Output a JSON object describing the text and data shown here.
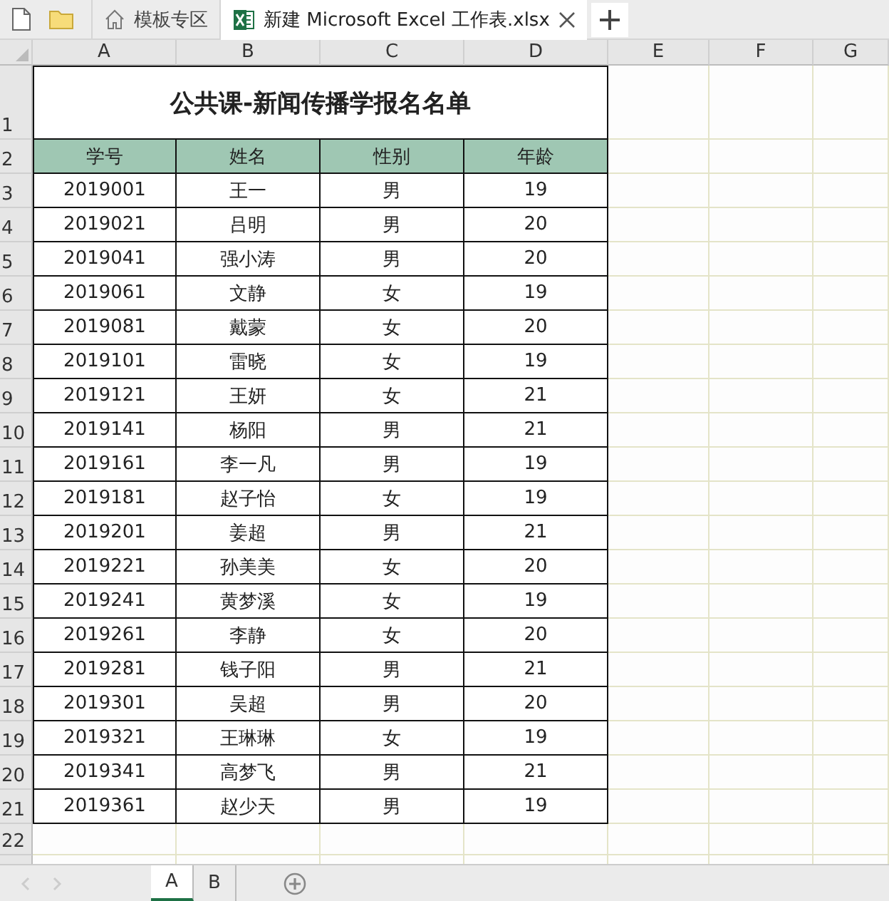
{
  "tabs": [
    {
      "label": "模板专区",
      "kind": "home",
      "selected": false
    },
    {
      "label": "新建 Microsoft Excel 工作表.xlsx",
      "kind": "excel",
      "selected": true
    }
  ],
  "columns": [
    "A",
    "B",
    "C",
    "D",
    "E",
    "F",
    "G"
  ],
  "row_numbers": [
    "1",
    "2",
    "3",
    "4",
    "5",
    "6",
    "7",
    "8",
    "9",
    "10",
    "11",
    "12",
    "13",
    "14",
    "15",
    "16",
    "17",
    "18",
    "19",
    "20",
    "21",
    "22"
  ],
  "title": "公共课-新闻传播学报名名单",
  "table": {
    "header": [
      "学号",
      "姓名",
      "性别",
      "年龄"
    ],
    "rows": [
      [
        "2019001",
        "王一",
        "男",
        "19"
      ],
      [
        "2019021",
        "吕明",
        "男",
        "20"
      ],
      [
        "2019041",
        "强小涛",
        "男",
        "20"
      ],
      [
        "2019061",
        "文静",
        "女",
        "19"
      ],
      [
        "2019081",
        "戴蒙",
        "女",
        "20"
      ],
      [
        "2019101",
        "雷晓",
        "女",
        "19"
      ],
      [
        "2019121",
        "王妍",
        "女",
        "21"
      ],
      [
        "2019141",
        "杨阳",
        "男",
        "21"
      ],
      [
        "2019161",
        "李一凡",
        "男",
        "19"
      ],
      [
        "2019181",
        "赵子怡",
        "女",
        "19"
      ],
      [
        "2019201",
        "姜超",
        "男",
        "21"
      ],
      [
        "2019221",
        "孙美美",
        "女",
        "20"
      ],
      [
        "2019241",
        "黄梦溪",
        "女",
        "19"
      ],
      [
        "2019261",
        "李静",
        "女",
        "20"
      ],
      [
        "2019281",
        "钱子阳",
        "男",
        "21"
      ],
      [
        "2019301",
        "吴超",
        "男",
        "20"
      ],
      [
        "2019321",
        "王琳琳",
        "女",
        "19"
      ],
      [
        "2019341",
        "高梦飞",
        "男",
        "21"
      ],
      [
        "2019361",
        "赵少天",
        "男",
        "19"
      ]
    ]
  },
  "sheets": [
    {
      "label": "A",
      "selected": true
    },
    {
      "label": "B",
      "selected": false
    }
  ]
}
